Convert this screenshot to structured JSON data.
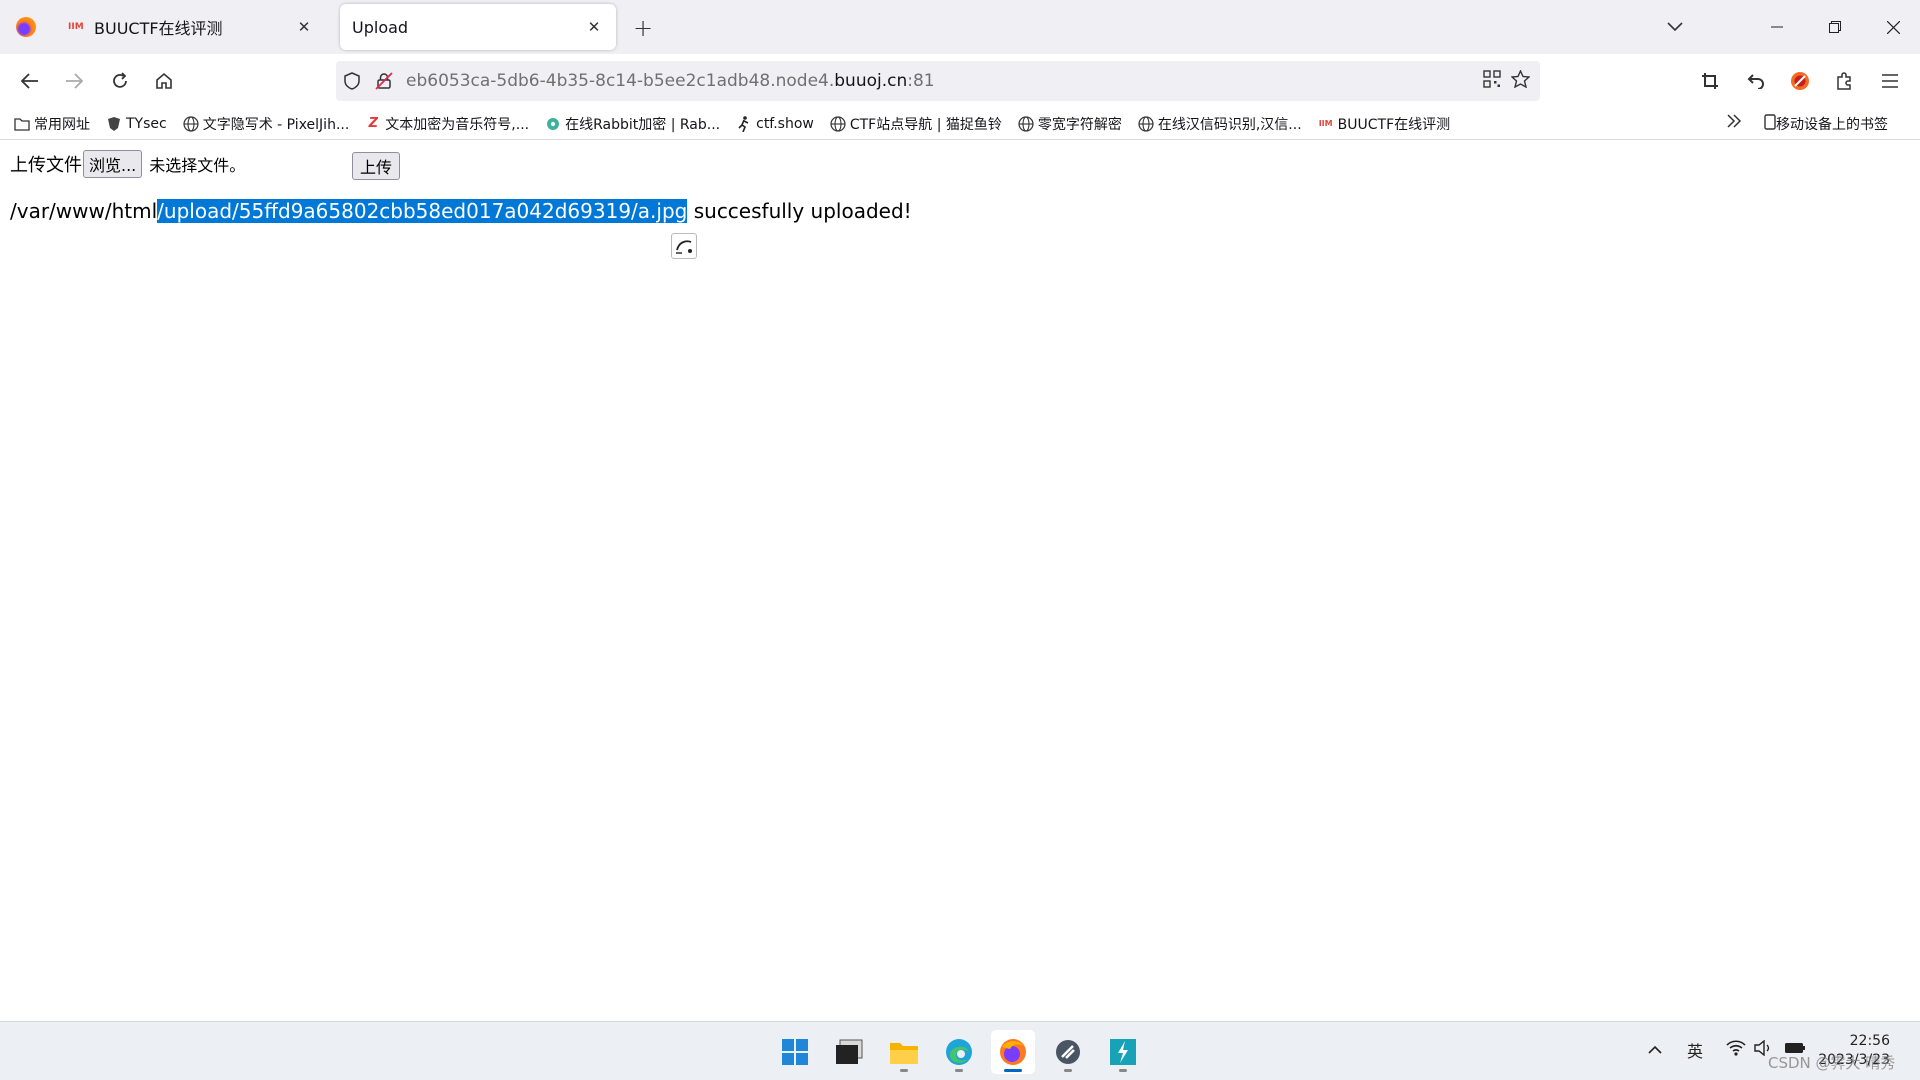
{
  "browser": {
    "tabs": [
      {
        "title": "BUUCTF在线评测",
        "favicon": "buuctf-icon",
        "active": false
      },
      {
        "title": "Upload",
        "favicon": "",
        "active": true
      }
    ],
    "url": {
      "prefix": "eb6053ca-5db6-4b35-8c14-b5ee2c1adb48.node4.",
      "domain": "buuoj.cn",
      "port": ":81"
    },
    "bookmarks": [
      {
        "label": "常用网址",
        "icon": "folder-icon"
      },
      {
        "label": "TYsec",
        "icon": "tysec-icon"
      },
      {
        "label": "文字隐写术 - PixelJih...",
        "icon": "globe-icon"
      },
      {
        "label": "文本加密为音乐符号,...",
        "icon": "zj-icon"
      },
      {
        "label": "在线Rabbit加密 | Rab...",
        "icon": "gear-icon"
      },
      {
        "label": "ctf.show",
        "icon": "runner-icon"
      },
      {
        "label": "CTF站点导航 | 猫捉鱼铃",
        "icon": "globe-icon"
      },
      {
        "label": "零宽字符解密",
        "icon": "globe-icon"
      },
      {
        "label": "在线汉信码识别,汉信...",
        "icon": "globe-icon"
      },
      {
        "label": "BUUCTF在线评测",
        "icon": "buuctf-icon"
      }
    ],
    "mobile_bookmarks": "移动设备上的书签"
  },
  "page": {
    "form_label": "上传文件",
    "browse_label": "浏览...",
    "file_status": "未选择文件。",
    "submit_label": "上传",
    "result": {
      "path_prefix": "/var/www/html",
      "path_selected": "/upload/55ffd9a65802cbb58ed017a042d69319/a.jpg",
      "suffix": " succesfully uploaded!"
    }
  },
  "taskbar": {
    "apps": [
      "windows-start-icon",
      "terminal-icon",
      "file-explorer-icon",
      "edge-icon",
      "firefox-icon",
      "tool-icon",
      "app-icon"
    ],
    "ime": "英",
    "time": "22:56",
    "date": "2023/3/23"
  },
  "watermark": "CSDN @霁大 晴秀"
}
